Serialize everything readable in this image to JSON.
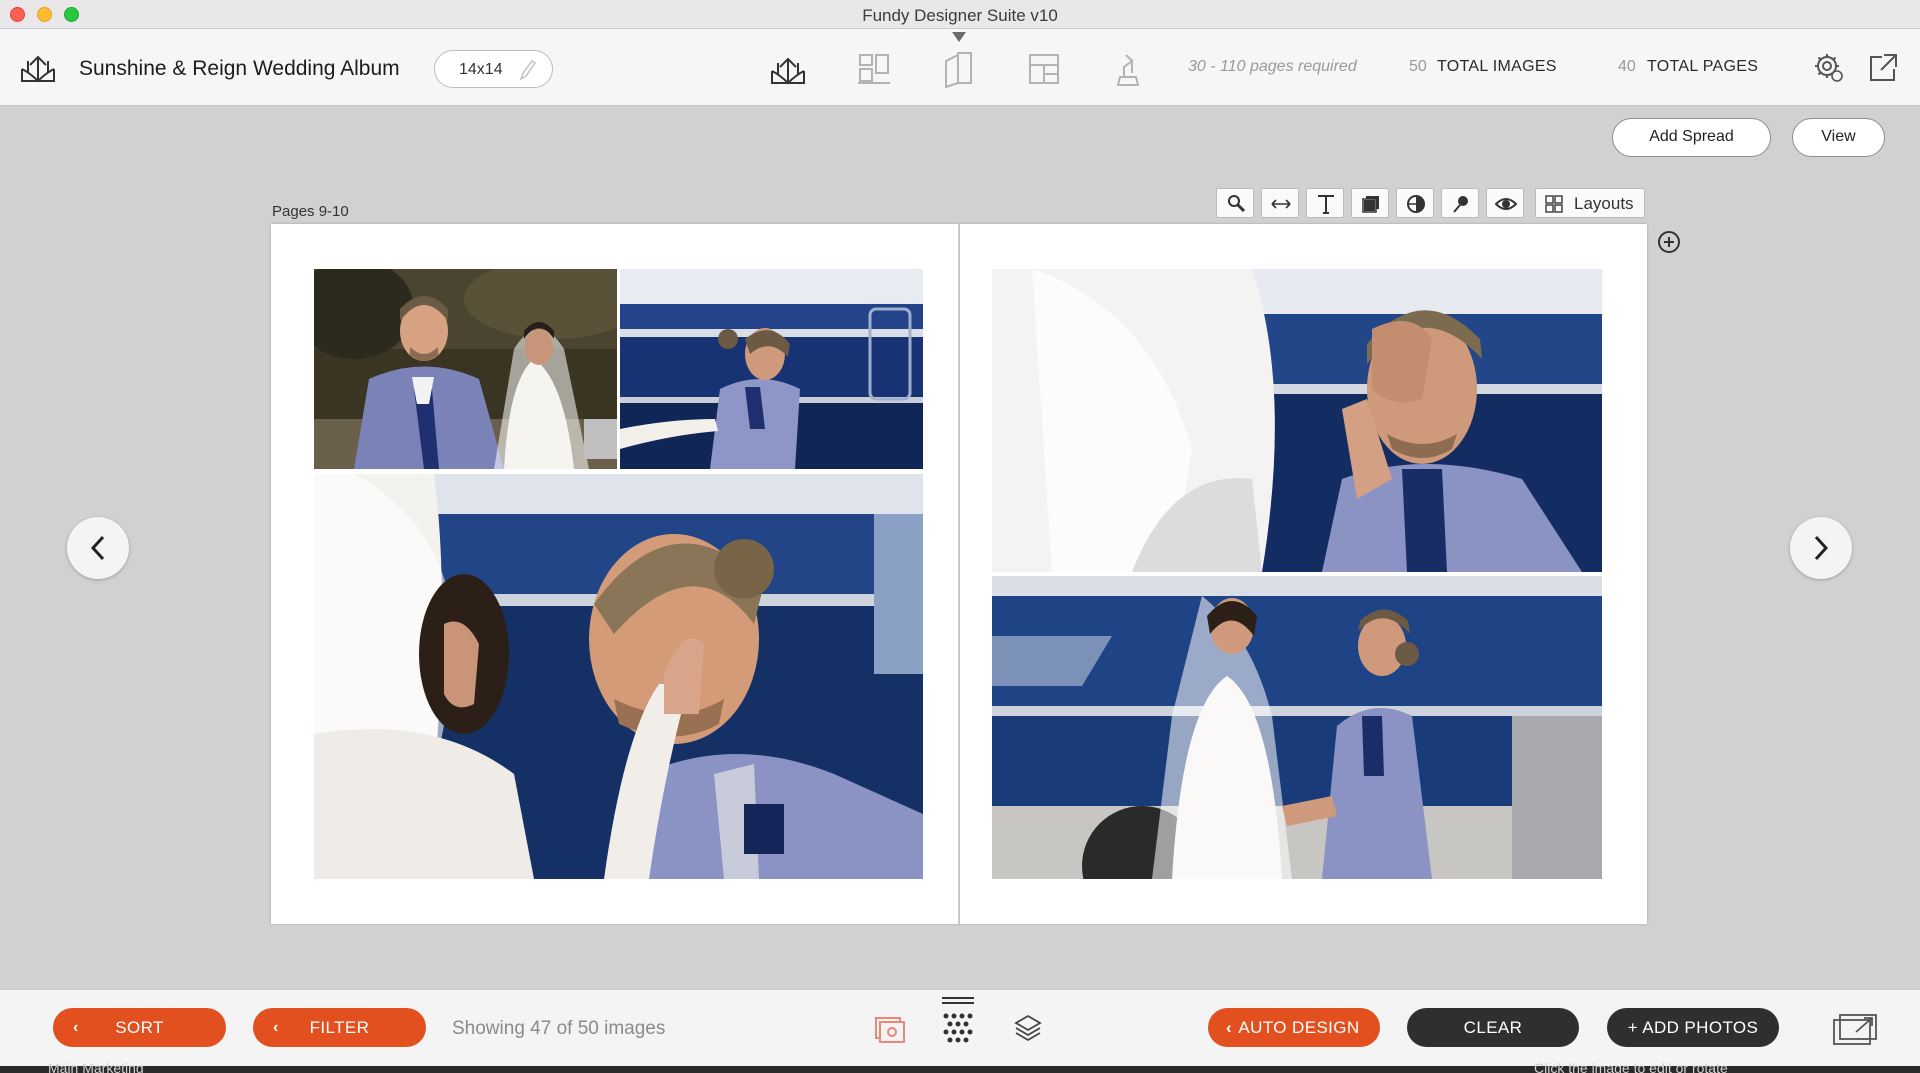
{
  "window": {
    "title": "Fundy Designer Suite v10"
  },
  "toolbar": {
    "album_title": "Sunshine & Reign Wedding Album",
    "album_size": "14x14",
    "pages_required": "30 - 110 pages required",
    "total_images_count": "50",
    "total_images_label": "TOTAL IMAGES",
    "total_pages_count": "40",
    "total_pages_label": "TOTAL PAGES",
    "nav_icons": [
      "album-design-icon",
      "wall-art-icon",
      "cards-icon",
      "layout-icon",
      "proofing-icon"
    ],
    "active_nav": "cards-icon"
  },
  "actions": {
    "add_spread": "Add Spread",
    "view": "View"
  },
  "spread": {
    "label": "Pages 9-10",
    "tools": [
      "zoom-icon",
      "swap-icon",
      "text-icon",
      "shadow-icon",
      "color-icon",
      "pin-icon",
      "preview-icon"
    ],
    "layouts_label": "Layouts",
    "left_page_photos": [
      "groom-bride-portrait",
      "bride-touching-groom-back",
      "bride-cupping-groom-face"
    ],
    "right_page_photos": [
      "groom-wiping-tears",
      "couple-laughing-by-truck"
    ]
  },
  "bottom": {
    "sort": "SORT",
    "filter": "FILTER",
    "showing": "Showing 47 of 50 images",
    "auto_design": "AUTO DESIGN",
    "clear": "CLEAR",
    "add_photos": "+ ADD PHOTOS",
    "strip_left": "Main Marketing",
    "strip_right": "Click the image to edit or rotate"
  },
  "colors": {
    "accent_orange": "#e2501f",
    "dark_button": "#2f2f2f"
  }
}
